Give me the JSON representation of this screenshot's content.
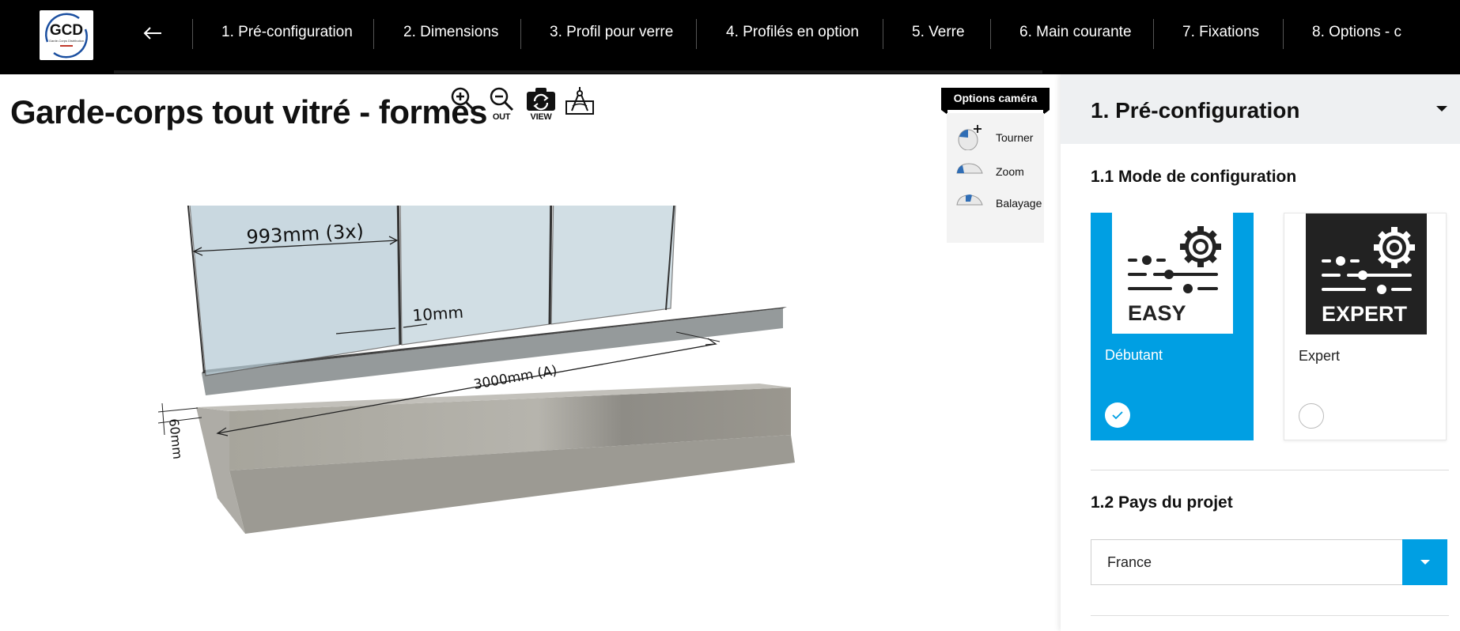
{
  "brand": {
    "logo_text": "GCD",
    "logo_subtext": "Garde-Corps Distribution",
    "accent_color": "#009fe3"
  },
  "nav": {
    "back_icon": "arrow-left-icon",
    "items": [
      {
        "label": "1. Pré-configuration"
      },
      {
        "label": "2. Dimensions"
      },
      {
        "label": "3. Profil pour verre"
      },
      {
        "label": "4. Profilés en option"
      },
      {
        "label": "5. Verre"
      },
      {
        "label": "6. Main courante"
      },
      {
        "label": "7. Fixations"
      },
      {
        "label": "8. Options - c"
      }
    ]
  },
  "page": {
    "title": "Garde-corps tout vitré - formes"
  },
  "toolbar": {
    "zoom_in_label": "",
    "zoom_out_label": "OUT",
    "view_label": "VIEW",
    "drawing_label": ""
  },
  "camera": {
    "title": "Options caméra",
    "options": [
      {
        "label": "Tourner",
        "icon": "mouse-rotate-icon"
      },
      {
        "label": "Zoom",
        "icon": "mouse-zoom-icon"
      },
      {
        "label": "Balayage",
        "icon": "mouse-pan-icon"
      }
    ]
  },
  "viewer": {
    "glass_width_label": "993mm (3x)",
    "gap_label": "10mm",
    "total_length_label": "3000mm (A)",
    "height_label": "60mm"
  },
  "panel": {
    "header": "1. Pré-configuration",
    "section1_title": "1.1 Mode de configuration",
    "modes": [
      {
        "badge": "EASY",
        "name": "Débutant",
        "selected": true
      },
      {
        "badge": "EXPERT",
        "name": "Expert",
        "selected": false
      }
    ],
    "section2_title": "1.2 Pays du projet",
    "country_value": "France"
  }
}
